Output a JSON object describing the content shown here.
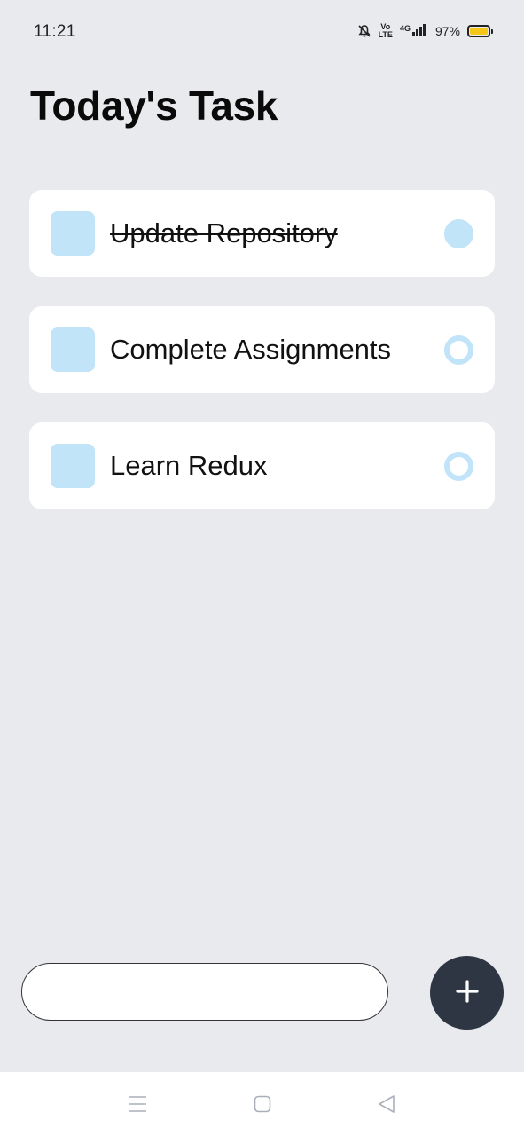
{
  "status_bar": {
    "time": "11:21",
    "volte_top": "Vo",
    "volte_bottom": "LTE",
    "network": "4G",
    "battery_percent": "97%",
    "battery_color": "#f5c518",
    "icons": [
      "mute-bell-icon",
      "volte-icon",
      "signal-icon",
      "battery-icon"
    ]
  },
  "header": {
    "title": "Today's Task"
  },
  "tasks": [
    {
      "text": "Update Repository",
      "completed": true
    },
    {
      "text": "Complete Assignments",
      "completed": false
    },
    {
      "text": "Learn Redux",
      "completed": false
    }
  ],
  "composer": {
    "input_value": "",
    "placeholder": "",
    "add_button_icon": "plus-icon"
  },
  "nav_bar": {
    "icons": [
      "menu-icon",
      "home-icon",
      "back-icon"
    ]
  },
  "colors": {
    "background": "#e8eaed",
    "card": "#ffffff",
    "accent": "#c1e4f9",
    "fab": "#2e3543"
  }
}
